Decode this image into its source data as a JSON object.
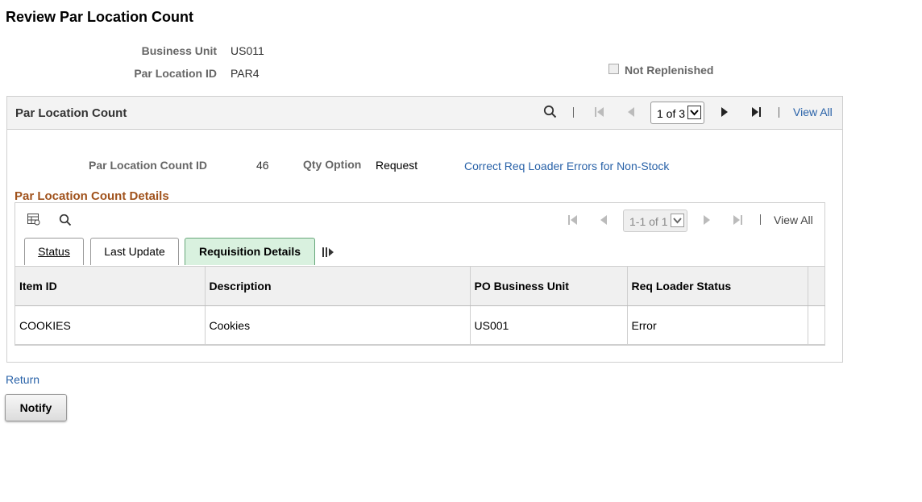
{
  "page": {
    "title": "Review Par Location Count"
  },
  "header_fields": {
    "business_unit_label": "Business Unit",
    "business_unit_value": "US011",
    "par_location_id_label": "Par Location ID",
    "par_location_id_value": "PAR4",
    "not_replenished_label": "Not Replenished",
    "not_replenished_checked": false
  },
  "par_location_count": {
    "title": "Par Location Count",
    "pager": {
      "selected": "1 of 3",
      "view_all": "View All"
    },
    "count_id_label": "Par Location Count ID",
    "count_id_value": "46",
    "qty_option_label": "Qty Option",
    "qty_option_value": "Request",
    "correct_link": "Correct Req Loader Errors for Non-Stock"
  },
  "details": {
    "title": "Par Location Count Details",
    "pager": {
      "selected": "1-1 of 1",
      "view_all": "View All"
    },
    "tabs": [
      {
        "label": "Status",
        "active": false
      },
      {
        "label": "Last Update",
        "active": false
      },
      {
        "label": "Requisition Details",
        "active": true
      }
    ],
    "columns": [
      "Item ID",
      "Description",
      "PO Business Unit",
      "Req Loader Status"
    ],
    "rows": [
      [
        "COOKIES",
        "Cookies",
        "US001",
        "Error"
      ]
    ]
  },
  "footer": {
    "return_link": "Return",
    "notify_button": "Notify"
  },
  "colors": {
    "link": "#2962a8",
    "section_title": "#a0521c",
    "active_tab": "#d9f1df"
  }
}
